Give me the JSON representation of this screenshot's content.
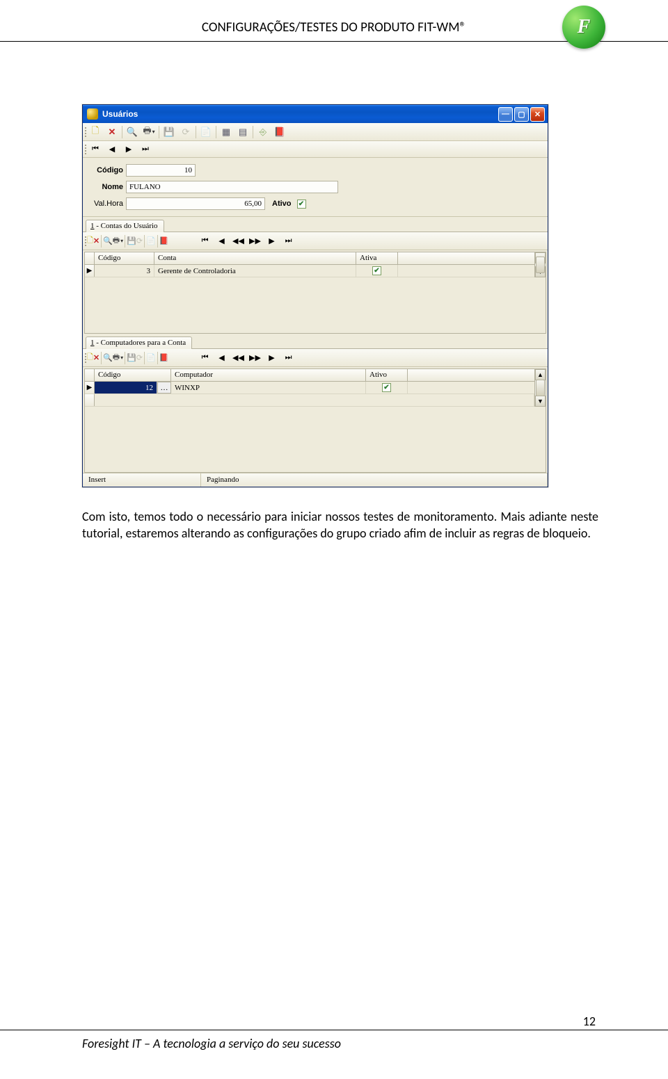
{
  "header": {
    "title": "CONFIGURAÇÕES/TESTES DO PRODUTO FIT-WM®",
    "logo_text": "F"
  },
  "window": {
    "title": "Usuários"
  },
  "form": {
    "codigo_label": "Código",
    "codigo_value": "10",
    "nome_label": "Nome",
    "nome_value": "FULANO",
    "valhora_label": "Val.Hora",
    "valhora_value": "65,00",
    "ativo_label": "Ativo",
    "ativo_checked": "✔"
  },
  "tab1": {
    "label": "1 - Contas do Usuário",
    "col_codigo": "Código",
    "col_conta": "Conta",
    "col_ativa": "Ativa",
    "row1_codigo": "3",
    "row1_conta": "Gerente de Controladoria",
    "row1_ativa": "✔"
  },
  "tab2": {
    "label": "1 - Computadores para a Conta",
    "col_codigo": "Código",
    "col_comp": "Computador",
    "col_ativo": "Ativo",
    "row1_codigo": "12",
    "row1_comp": "WINXP",
    "row1_ativo": "✔"
  },
  "status": {
    "left": "Insert",
    "right": "Paginando"
  },
  "body_text": "Com isto, temos todo o necessário para iniciar nossos testes de monitoramento. Mais adiante neste tutorial, estaremos alterando as configurações do grupo criado afim de incluir as regras de bloqueio.",
  "footer": "Foresight IT – A tecnologia a serviço do seu sucesso",
  "page_number": "12"
}
